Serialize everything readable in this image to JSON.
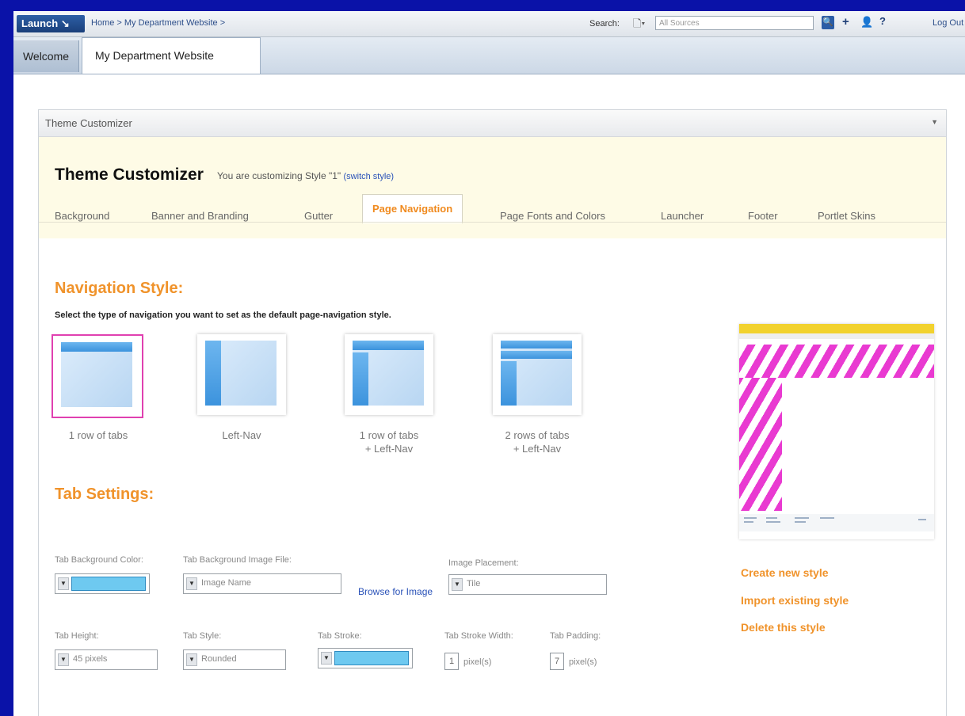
{
  "topbar": {
    "launch_label": "Launch ↘",
    "breadcrumb": "Home > My Department Website >",
    "search_label": "Search:",
    "source_value": "All Sources",
    "logout_label": "Log Out"
  },
  "tabs": {
    "welcome": "Welcome",
    "current": "My Department Website"
  },
  "portlet": {
    "title": "Theme Customizer"
  },
  "customizer": {
    "title": "Theme Customizer",
    "subtitle": "You are customizing Style \"1\"",
    "switch_link": "(switch style)",
    "tabs": [
      "Background",
      "Banner and Branding",
      "Gutter",
      "Page Navigation",
      "Page Fonts and Colors",
      "Launcher",
      "Footer",
      "Portlet Skins"
    ],
    "active_tab": "Page Navigation"
  },
  "navigation_style": {
    "heading": "Navigation Style:",
    "instruction": "Select the type of navigation you want to set as the default page-navigation style.",
    "options": [
      {
        "line1": "1 row of tabs",
        "line2": ""
      },
      {
        "line1": "Left-Nav",
        "line2": ""
      },
      {
        "line1": "1 row of tabs",
        "line2": "+ Left-Nav"
      },
      {
        "line1": "2 rows of tabs",
        "line2": "+ Left-Nav"
      }
    ],
    "selected": "1 row of tabs"
  },
  "tab_settings": {
    "heading": "Tab Settings:",
    "bg_color_label": "Tab Background Color:",
    "bg_image_label": "Tab Background Image File:",
    "bg_image_value": "Image Name",
    "browse_label": "Browse for Image",
    "placement_label": "Image Placement:",
    "placement_value": "Tile",
    "height_label": "Tab Height:",
    "height_value": "45 pixels",
    "style_label": "Tab Style:",
    "style_value": "Rounded",
    "stroke_label": "Tab Stroke:",
    "stroke_width_label": "Tab Stroke Width:",
    "stroke_width_value": "1",
    "padding_label": "Tab Padding:",
    "padding_value": "7",
    "unit": "pixel(s)",
    "swatch_color": "#6ec9f0"
  },
  "actions": {
    "create": "Create new style",
    "import": "Import existing style",
    "delete": "Delete this style"
  },
  "colors": {
    "accent_orange": "#f0932b",
    "selection_magenta": "#e040b0",
    "link_blue": "#2a52b8"
  }
}
